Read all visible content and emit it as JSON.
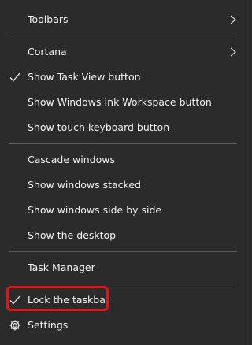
{
  "menu": {
    "items": {
      "toolbars": "Toolbars",
      "cortana": "Cortana",
      "show_task_view": "Show Task View button",
      "show_ink_workspace": "Show Windows Ink Workspace button",
      "show_touch_keyboard": "Show touch keyboard button",
      "cascade_windows": "Cascade windows",
      "show_stacked": "Show windows stacked",
      "show_side_by_side": "Show windows side by side",
      "show_desktop": "Show the desktop",
      "task_manager": "Task Manager",
      "lock_taskbar": "Lock the taskbar",
      "settings": "Settings"
    },
    "checked": {
      "show_task_view": true,
      "lock_taskbar": true
    },
    "icons": {
      "submenu": "chevron-right-icon",
      "check": "checkmark-icon",
      "settings": "gear-icon"
    },
    "colors": {
      "background": "#2b2b2b",
      "text": "#f2f2f2",
      "separator": "#5c5c5c",
      "highlight": "#e0151b"
    }
  }
}
